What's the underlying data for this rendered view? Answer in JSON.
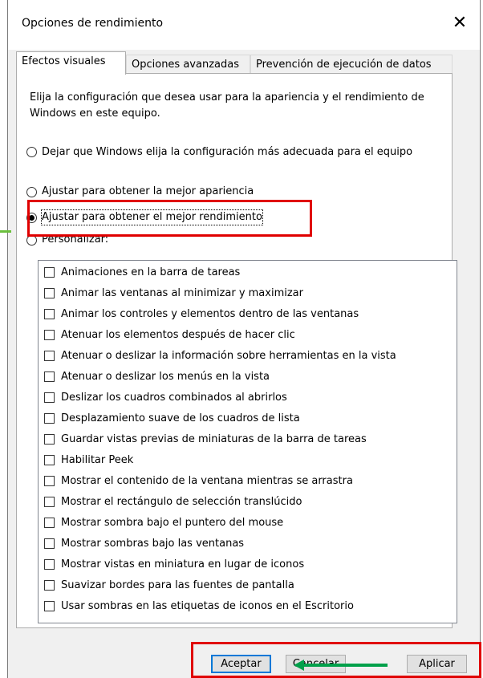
{
  "window": {
    "title": "Opciones de rendimiento",
    "close_glyph": "✕"
  },
  "tabs": [
    {
      "label": "Efectos visuales",
      "active": true
    },
    {
      "label": "Opciones avanzadas",
      "active": false
    },
    {
      "label": "Prevención de ejecución de datos",
      "active": false
    }
  ],
  "description": "Elija la configuración que desea usar para la apariencia y el rendimiento de Windows en este equipo.",
  "radios": [
    {
      "label": "Dejar que Windows elija la configuración más adecuada para el equipo",
      "selected": false
    },
    {
      "label": "Ajustar para obtener la mejor apariencia",
      "selected": false
    },
    {
      "label": "Ajustar para obtener el mejor rendimiento",
      "selected": true
    },
    {
      "label": "Personalizar:",
      "selected": false
    }
  ],
  "checkboxes": [
    "Animaciones en la barra de tareas",
    "Animar las ventanas al minimizar y maximizar",
    "Animar los controles y elementos dentro de las ventanas",
    "Atenuar los elementos después de hacer clic",
    "Atenuar o deslizar la información sobre herramientas en la vista",
    "Atenuar o deslizar los menús en la vista",
    "Deslizar los cuadros combinados al abrirlos",
    "Desplazamiento suave de los cuadros de lista",
    "Guardar vistas previas de miniaturas de la barra de tareas",
    "Habilitar Peek",
    "Mostrar el contenido de la ventana mientras se arrastra",
    "Mostrar el rectángulo de selección translúcido",
    "Mostrar sombra bajo el puntero del mouse",
    "Mostrar sombras bajo las ventanas",
    "Mostrar vistas en miniatura en lugar de iconos",
    "Suavizar bordes para las fuentes de pantalla",
    "Usar sombras en las etiquetas de iconos en el Escritorio"
  ],
  "buttons": {
    "ok": "Aceptar",
    "cancel": "Cancelar",
    "apply": "Aplicar"
  },
  "colors": {
    "highlight": "#e00000",
    "arrow": "#00a04a",
    "accent": "#0078d7"
  }
}
